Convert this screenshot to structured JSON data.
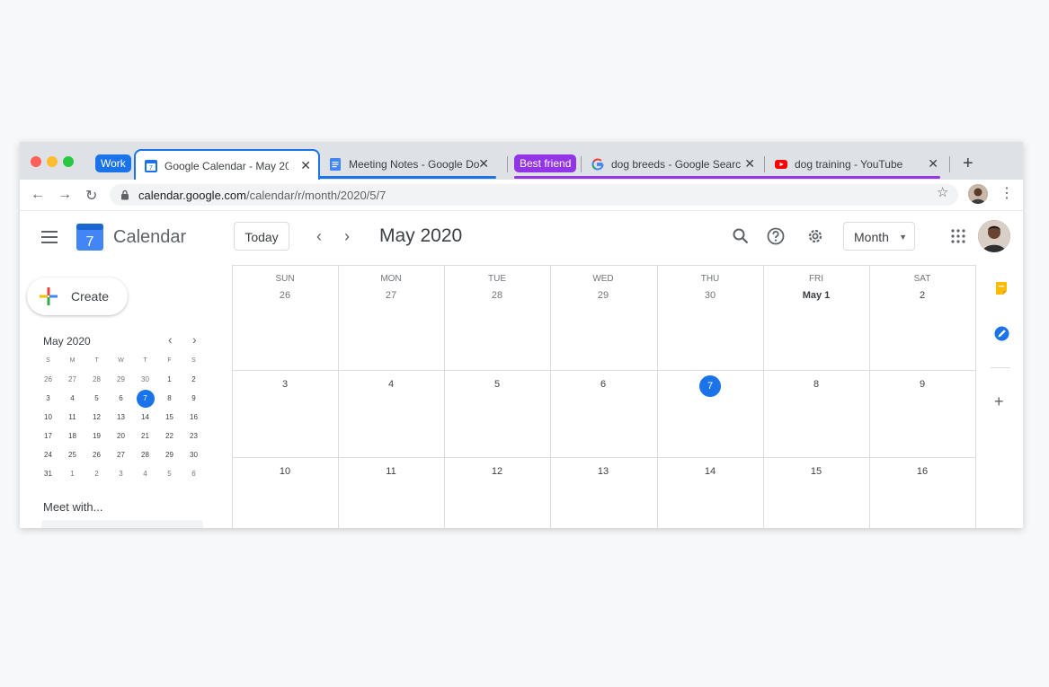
{
  "browser": {
    "tab_groups": [
      {
        "label": "Work",
        "color": "#1a73e8"
      },
      {
        "label": "Best friend",
        "color": "#9334e6"
      }
    ],
    "tabs": [
      {
        "title": "Google Calendar - May 20",
        "icon": "calendar-favicon-icon"
      },
      {
        "title": "Meeting Notes - Google Do",
        "icon": "docs-favicon-icon"
      },
      {
        "title": "dog breeds - Google Searc",
        "icon": "google-favicon-icon"
      },
      {
        "title": "dog training - YouTube",
        "icon": "youtube-favicon-icon"
      }
    ],
    "close_glyph": "✕",
    "new_tab_glyph": "+",
    "address": {
      "host": "calendar.google.com",
      "path": "/calendar/r/month/2020/5/7"
    },
    "back_glyph": "←",
    "forward_glyph": "→",
    "reload_glyph": "↻",
    "star_glyph": "☆",
    "menu_glyph": "⋮"
  },
  "header": {
    "app_name": "Calendar",
    "logo_day": "7",
    "today_label": "Today",
    "prev_glyph": "‹",
    "next_glyph": "›",
    "title": "May 2020",
    "view_label": "Month",
    "caret_glyph": "▼"
  },
  "sidebar": {
    "create_label": "Create",
    "mini_title": "May 2020",
    "mini_prev": "‹",
    "mini_next": "›",
    "mini_headers": [
      "S",
      "M",
      "T",
      "W",
      "T",
      "F",
      "S"
    ],
    "mini_weeks": [
      [
        "26",
        "27",
        "28",
        "29",
        "30",
        "1",
        "2"
      ],
      [
        "3",
        "4",
        "5",
        "6",
        "7",
        "8",
        "9"
      ],
      [
        "10",
        "11",
        "12",
        "13",
        "14",
        "15",
        "16"
      ],
      [
        "17",
        "18",
        "19",
        "20",
        "21",
        "22",
        "23"
      ],
      [
        "24",
        "25",
        "26",
        "27",
        "28",
        "29",
        "30"
      ],
      [
        "31",
        "1",
        "2",
        "3",
        "4",
        "5",
        "6"
      ]
    ],
    "meet_with_label": "Meet with..."
  },
  "month_grid": {
    "days_of_week": [
      "SUN",
      "MON",
      "TUE",
      "WED",
      "THU",
      "FRI",
      "SAT"
    ],
    "weeks": [
      [
        "26",
        "27",
        "28",
        "29",
        "30",
        "May 1",
        "2"
      ],
      [
        "3",
        "4",
        "5",
        "6",
        "7",
        "8",
        "9"
      ],
      [
        "10",
        "11",
        "12",
        "13",
        "14",
        "15",
        "16"
      ]
    ],
    "today": "7"
  },
  "side_panel": {
    "add_glyph": "+"
  },
  "colors": {
    "accent": "#1a73e8",
    "group_purple": "#9334e6",
    "keep_yellow": "#fbbc04"
  }
}
